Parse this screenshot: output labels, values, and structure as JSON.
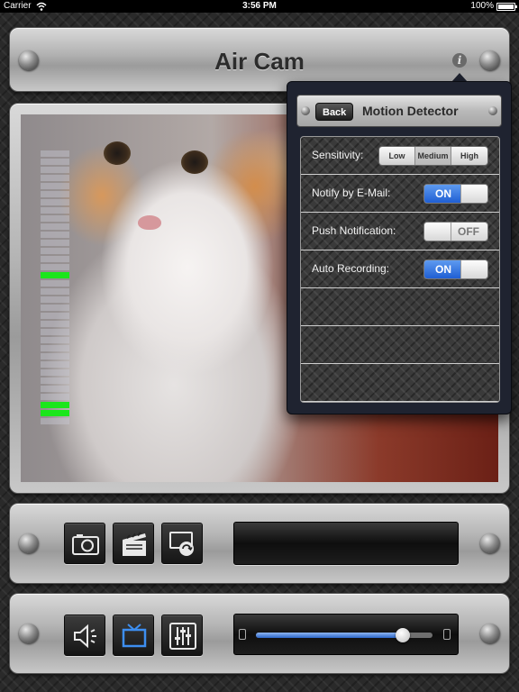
{
  "status_bar": {
    "carrier": "Carrier",
    "time": "3:56 PM",
    "battery": "100%"
  },
  "header": {
    "title": "Air Cam",
    "info_icon": "info-icon"
  },
  "video": {
    "level_meter_segments": 34,
    "level_meter_lit": [
      15,
      31,
      32
    ]
  },
  "controls": {
    "snapshot_icon": "camera-icon",
    "record_icon": "clapperboard-icon",
    "switch_camera_icon": "camera-switch-icon",
    "speaker_icon": "speaker-icon",
    "screen_icon": "tv-icon",
    "settings_icon": "equalizer-icon",
    "volume_level": 0.83
  },
  "popover": {
    "back_label": "Back",
    "title": "Motion Detector",
    "rows": [
      {
        "label": "Sensitivity:",
        "segments": [
          "Low",
          "Medium",
          "High"
        ],
        "selected": "Medium"
      },
      {
        "label": "Notify by E-Mail:",
        "toggle": "ON"
      },
      {
        "label": "Push Notification:",
        "toggle": "OFF"
      },
      {
        "label": "Auto Recording:",
        "toggle": "ON"
      }
    ]
  },
  "colors": {
    "accent_blue": "#2b66c9",
    "level_green": "#1be61b"
  }
}
